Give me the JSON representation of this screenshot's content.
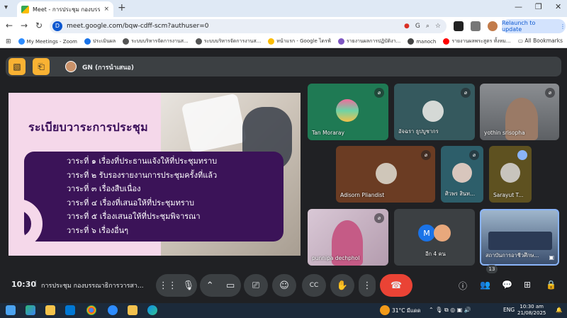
{
  "browser": {
    "tab_title": "Meet - การประชุม กองบรรณาธิการ",
    "tab_close": "×",
    "new_tab": "+",
    "url": "meet.google.com/bqw-cdff-scm?authuser=0",
    "relaunch_label": "Relaunch to update",
    "bookmarks": [
      {
        "label": "My Meetings - Zoom",
        "color": "#2d8cff"
      },
      {
        "label": "ประเมินผล",
        "color": "#1a73e8"
      },
      {
        "label": "ระบบบริหารจัดการงานส...",
        "color": "#555555"
      },
      {
        "label": "ระบบบริหารจัดการงานส...",
        "color": "#555555"
      },
      {
        "label": "หน้าแรก - Google ไดรฟ์",
        "color": "#fbbc04"
      },
      {
        "label": "รายงานผลการปฏิบัติงา...",
        "color": "#7e57c2"
      },
      {
        "label": "manoch",
        "color": "#444444"
      },
      {
        "label": "รายงานผลพระสูตร ทั้งหม...",
        "color": "#ff0000"
      }
    ],
    "all_bookmarks": "All Bookmarks"
  },
  "meet": {
    "presenter_label": "GN (การนำเสนอ)",
    "slide": {
      "title": "ระเบียบวาระการประชุม",
      "items": [
        "วาระที่ ๑ เรื่องที่ประธานแจ้งให้ที่ประชุมทราบ",
        "วาระที่ ๒ รับรองรายงานการประชุมครั้งที่แล้ว",
        "วาระที่ ๓ เรื่องสืบเนื่อง",
        "วาระที่ ๔ เรื่องที่เสนอให้ที่ประชุมทราบ",
        "วาระที่ ๕ เรื่องเสนอให้ที่ประชุมพิจารณา",
        "วาระที่ ๖ เรื่องอื่นๆ"
      ]
    },
    "participants": [
      {
        "name": "Tan Moraray"
      },
      {
        "name": "อัจฉรา ธูปบูชากร"
      },
      {
        "name": "yothin srisopha"
      },
      {
        "name": "Adisorn Pliandist"
      },
      {
        "name": "ศิวพร สินท..."
      },
      {
        "name": "Sarayut T..."
      },
      {
        "name": "punnipa dechphol"
      },
      {
        "name": "สถาบันการอาชีวศึกษ..."
      }
    ],
    "others_label": "อีก 4 คน",
    "others_initial": "M",
    "clock": "10:30",
    "meeting_title": "การประชุม กองบรรณาธิการวารสา...",
    "people_count": "13"
  },
  "taskbar": {
    "weather": "31°C มีแดด",
    "lang": "ENG",
    "time": "10:30 am",
    "date": "21/08/2025"
  }
}
